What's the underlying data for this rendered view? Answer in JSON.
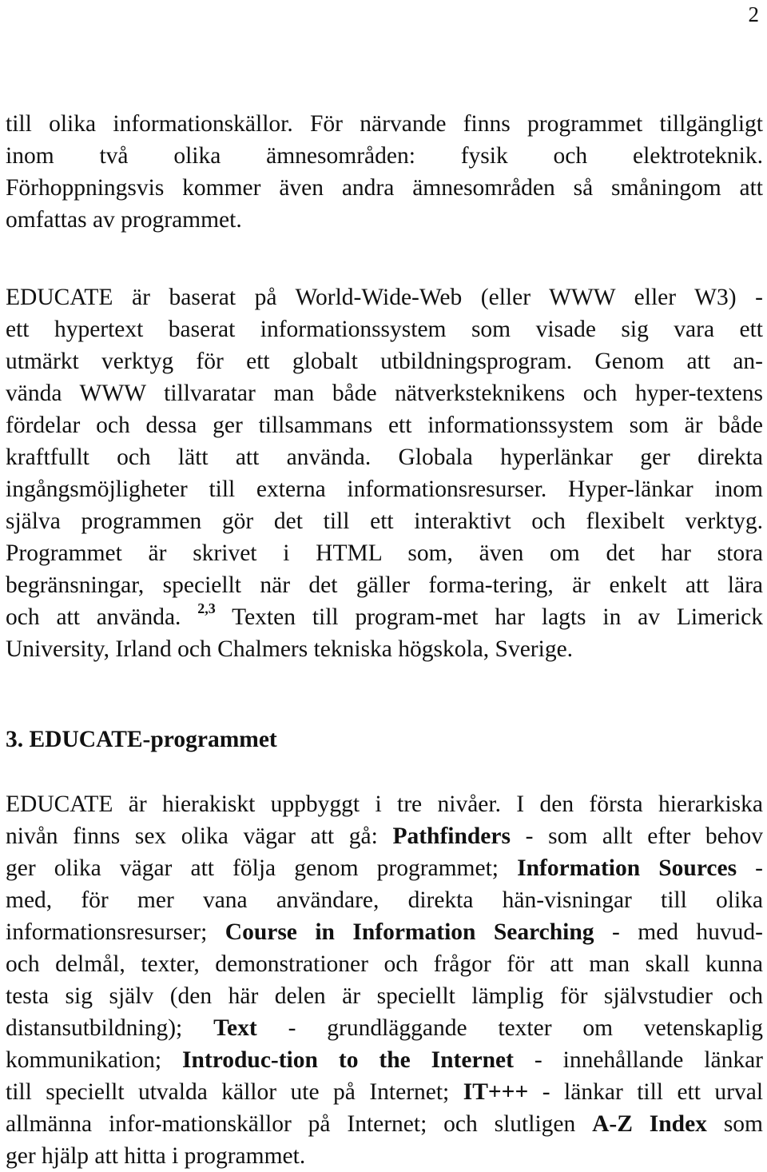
{
  "page": {
    "number": "2"
  },
  "paragraph_1": {
    "lines": [
      "till olika informationskällor. För närvande finns programmet tillgängligt",
      "inom två olika ämnesområden: fysik och elektroteknik.",
      "Förhoppningsvis kommer även andra ämnesområden så småningom att",
      "omfattas av programmet."
    ]
  },
  "paragraph_2": {
    "lines": [
      "EDUCATE är baserat på World-Wide-Web (eller WWW eller W3) -",
      "ett hypertext baserat informationssystem som visade sig vara ett",
      "utmärkt verktyg för ett globalt utbildningsprogram. Genom att an-",
      "vända WWW tillvaratar man både nätverksteknikens och hyper-textens",
      "fördelar och dessa ger tillsammans ett informationssystem som är både",
      "kraftfullt och lätt att använda. Globala hyperlänkar ger direkta",
      "ingångsmöjligheter till externa informationsresurser. Hyper-länkar inom",
      "själva programmen gör det till ett interaktivt och flexibelt verktyg.",
      "Programmet är skrivet i HTML som, även om det har stora",
      "begränsningar, speciellt när det gäller forma-tering, är enkelt att lära"
    ],
    "line_11_before_ref": "och att använda.",
    "reference": "2,3",
    "line_11_after_ref": "Texten till program-met har lagts in av Limerick",
    "line_12": "University, Irland och Chalmers tekniska högskola, Sverige."
  },
  "section": {
    "heading": "3. EDUCATE-programmet"
  },
  "paragraph_3": {
    "l1": "EDUCATE är hierakiskt uppbyggt i tre nivåer. I den första hierarkiska",
    "l2_pre": "nivån finns sex olika vägar att gå:",
    "term_pathfinders": "Pathfinders",
    "l2_post": "- som allt efter behov",
    "l3_pre": "ger olika vägar att följa genom programmet;",
    "term_information_sources": "Information Sources",
    "l3_post": "-",
    "l4": "med, för mer vana användare, direkta hän-visningar till olika",
    "l5_pre": "informationsresurser;",
    "term_course": "Course in Information Searching",
    "l5_post": "- med huvud-",
    "l6": "och delmål, texter, demonstrationer och frågor för att man skall kunna",
    "l7": "testa sig själv (den här delen är speciellt lämplig för självstudier och",
    "l8_pre": "distansutbildning);",
    "term_text": "Text",
    "l8_post": "- grundläggande texter om vetenskaplig",
    "l9_pre": "kommunikation;",
    "term_intro": "Introduc-tion to the Internet",
    "l9_post": "- innehållande länkar",
    "l10_pre": "till speciellt utvalda källor ute på Internet;",
    "term_it": "IT+++",
    "l10_post": "- länkar till ett urval",
    "l11_pre": "allmänna infor-mationskällor på Internet; och slutligen",
    "term_az": "A-Z Index",
    "l11_post": "som",
    "l12": "ger hjälp att hitta i programmet."
  }
}
